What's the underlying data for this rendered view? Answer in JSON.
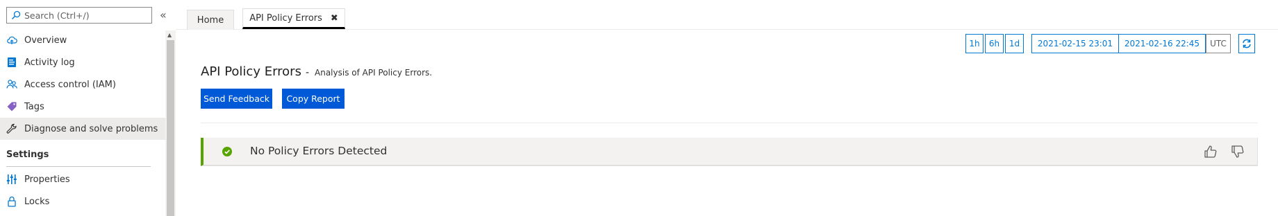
{
  "sidebar": {
    "search_placeholder": "Search (Ctrl+/)",
    "collapse_glyph": "«",
    "items": [
      {
        "label": "Overview",
        "icon": "cloud-upload-icon"
      },
      {
        "label": "Activity log",
        "icon": "activity-log-icon"
      },
      {
        "label": "Access control (IAM)",
        "icon": "people-icon"
      },
      {
        "label": "Tags",
        "icon": "tag-icon"
      },
      {
        "label": "Diagnose and solve problems",
        "icon": "wrench-icon",
        "active": true
      }
    ],
    "settings_heading": "Settings",
    "settings_items": [
      {
        "label": "Properties",
        "icon": "properties-icon"
      },
      {
        "label": "Locks",
        "icon": "lock-icon"
      }
    ]
  },
  "tabs": {
    "home": "Home",
    "active": "API Policy Errors",
    "close_glyph": "✖"
  },
  "time": {
    "ranges": [
      "1h",
      "6h",
      "1d"
    ],
    "start": "2021-02-15 23:01",
    "end": "2021-02-16 22:45",
    "tz": "UTC"
  },
  "main": {
    "title": "API Policy Errors",
    "separator": "-",
    "subtitle": "Analysis of API Policy Errors.",
    "send_feedback": "Send Feedback",
    "copy_report": "Copy Report",
    "status_message": "No Policy Errors Detected"
  },
  "colors": {
    "accent": "#0078d4",
    "button": "#0059d6",
    "success": "#57a300"
  }
}
